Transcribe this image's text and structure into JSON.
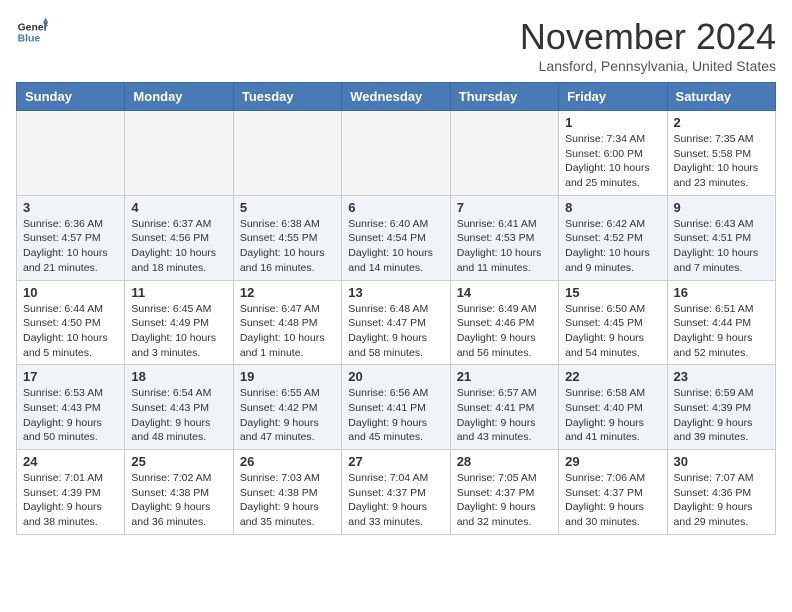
{
  "logo": {
    "general": "General",
    "blue": "Blue"
  },
  "title": "November 2024",
  "location": "Lansford, Pennsylvania, United States",
  "days_of_week": [
    "Sunday",
    "Monday",
    "Tuesday",
    "Wednesday",
    "Thursday",
    "Friday",
    "Saturday"
  ],
  "weeks": [
    [
      {
        "day": "",
        "empty": true
      },
      {
        "day": "",
        "empty": true
      },
      {
        "day": "",
        "empty": true
      },
      {
        "day": "",
        "empty": true
      },
      {
        "day": "",
        "empty": true
      },
      {
        "day": "1",
        "sunrise": "Sunrise: 7:34 AM",
        "sunset": "Sunset: 6:00 PM",
        "daylight": "Daylight: 10 hours and 25 minutes."
      },
      {
        "day": "2",
        "sunrise": "Sunrise: 7:35 AM",
        "sunset": "Sunset: 5:58 PM",
        "daylight": "Daylight: 10 hours and 23 minutes."
      }
    ],
    [
      {
        "day": "3",
        "sunrise": "Sunrise: 6:36 AM",
        "sunset": "Sunset: 4:57 PM",
        "daylight": "Daylight: 10 hours and 21 minutes."
      },
      {
        "day": "4",
        "sunrise": "Sunrise: 6:37 AM",
        "sunset": "Sunset: 4:56 PM",
        "daylight": "Daylight: 10 hours and 18 minutes."
      },
      {
        "day": "5",
        "sunrise": "Sunrise: 6:38 AM",
        "sunset": "Sunset: 4:55 PM",
        "daylight": "Daylight: 10 hours and 16 minutes."
      },
      {
        "day": "6",
        "sunrise": "Sunrise: 6:40 AM",
        "sunset": "Sunset: 4:54 PM",
        "daylight": "Daylight: 10 hours and 14 minutes."
      },
      {
        "day": "7",
        "sunrise": "Sunrise: 6:41 AM",
        "sunset": "Sunset: 4:53 PM",
        "daylight": "Daylight: 10 hours and 11 minutes."
      },
      {
        "day": "8",
        "sunrise": "Sunrise: 6:42 AM",
        "sunset": "Sunset: 4:52 PM",
        "daylight": "Daylight: 10 hours and 9 minutes."
      },
      {
        "day": "9",
        "sunrise": "Sunrise: 6:43 AM",
        "sunset": "Sunset: 4:51 PM",
        "daylight": "Daylight: 10 hours and 7 minutes."
      }
    ],
    [
      {
        "day": "10",
        "sunrise": "Sunrise: 6:44 AM",
        "sunset": "Sunset: 4:50 PM",
        "daylight": "Daylight: 10 hours and 5 minutes."
      },
      {
        "day": "11",
        "sunrise": "Sunrise: 6:45 AM",
        "sunset": "Sunset: 4:49 PM",
        "daylight": "Daylight: 10 hours and 3 minutes."
      },
      {
        "day": "12",
        "sunrise": "Sunrise: 6:47 AM",
        "sunset": "Sunset: 4:48 PM",
        "daylight": "Daylight: 10 hours and 1 minute."
      },
      {
        "day": "13",
        "sunrise": "Sunrise: 6:48 AM",
        "sunset": "Sunset: 4:47 PM",
        "daylight": "Daylight: 9 hours and 58 minutes."
      },
      {
        "day": "14",
        "sunrise": "Sunrise: 6:49 AM",
        "sunset": "Sunset: 4:46 PM",
        "daylight": "Daylight: 9 hours and 56 minutes."
      },
      {
        "day": "15",
        "sunrise": "Sunrise: 6:50 AM",
        "sunset": "Sunset: 4:45 PM",
        "daylight": "Daylight: 9 hours and 54 minutes."
      },
      {
        "day": "16",
        "sunrise": "Sunrise: 6:51 AM",
        "sunset": "Sunset: 4:44 PM",
        "daylight": "Daylight: 9 hours and 52 minutes."
      }
    ],
    [
      {
        "day": "17",
        "sunrise": "Sunrise: 6:53 AM",
        "sunset": "Sunset: 4:43 PM",
        "daylight": "Daylight: 9 hours and 50 minutes."
      },
      {
        "day": "18",
        "sunrise": "Sunrise: 6:54 AM",
        "sunset": "Sunset: 4:43 PM",
        "daylight": "Daylight: 9 hours and 48 minutes."
      },
      {
        "day": "19",
        "sunrise": "Sunrise: 6:55 AM",
        "sunset": "Sunset: 4:42 PM",
        "daylight": "Daylight: 9 hours and 47 minutes."
      },
      {
        "day": "20",
        "sunrise": "Sunrise: 6:56 AM",
        "sunset": "Sunset: 4:41 PM",
        "daylight": "Daylight: 9 hours and 45 minutes."
      },
      {
        "day": "21",
        "sunrise": "Sunrise: 6:57 AM",
        "sunset": "Sunset: 4:41 PM",
        "daylight": "Daylight: 9 hours and 43 minutes."
      },
      {
        "day": "22",
        "sunrise": "Sunrise: 6:58 AM",
        "sunset": "Sunset: 4:40 PM",
        "daylight": "Daylight: 9 hours and 41 minutes."
      },
      {
        "day": "23",
        "sunrise": "Sunrise: 6:59 AM",
        "sunset": "Sunset: 4:39 PM",
        "daylight": "Daylight: 9 hours and 39 minutes."
      }
    ],
    [
      {
        "day": "24",
        "sunrise": "Sunrise: 7:01 AM",
        "sunset": "Sunset: 4:39 PM",
        "daylight": "Daylight: 9 hours and 38 minutes."
      },
      {
        "day": "25",
        "sunrise": "Sunrise: 7:02 AM",
        "sunset": "Sunset: 4:38 PM",
        "daylight": "Daylight: 9 hours and 36 minutes."
      },
      {
        "day": "26",
        "sunrise": "Sunrise: 7:03 AM",
        "sunset": "Sunset: 4:38 PM",
        "daylight": "Daylight: 9 hours and 35 minutes."
      },
      {
        "day": "27",
        "sunrise": "Sunrise: 7:04 AM",
        "sunset": "Sunset: 4:37 PM",
        "daylight": "Daylight: 9 hours and 33 minutes."
      },
      {
        "day": "28",
        "sunrise": "Sunrise: 7:05 AM",
        "sunset": "Sunset: 4:37 PM",
        "daylight": "Daylight: 9 hours and 32 minutes."
      },
      {
        "day": "29",
        "sunrise": "Sunrise: 7:06 AM",
        "sunset": "Sunset: 4:37 PM",
        "daylight": "Daylight: 9 hours and 30 minutes."
      },
      {
        "day": "30",
        "sunrise": "Sunrise: 7:07 AM",
        "sunset": "Sunset: 4:36 PM",
        "daylight": "Daylight: 9 hours and 29 minutes."
      }
    ]
  ]
}
